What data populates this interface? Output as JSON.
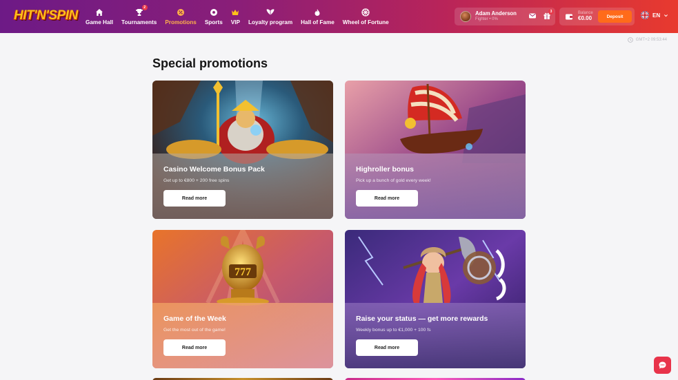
{
  "brand": {
    "logo_text": "HIT'N'SPIN"
  },
  "nav": {
    "items": [
      {
        "label": "Game Hall",
        "icon": "home-icon",
        "active": false
      },
      {
        "label": "Tournaments",
        "icon": "trophy-icon",
        "badge": "2",
        "active": false
      },
      {
        "label": "Promotions",
        "icon": "promo-icon",
        "active": true
      },
      {
        "label": "Sports",
        "icon": "ball-icon",
        "active": false
      },
      {
        "label": "VIP",
        "icon": "crown-icon",
        "active": false
      },
      {
        "label": "Loyalty program",
        "icon": "wings-icon",
        "active": false
      },
      {
        "label": "Hall of Fame",
        "icon": "flame-icon",
        "active": false
      },
      {
        "label": "Wheel of Fortune",
        "icon": "wheel-icon",
        "active": false
      }
    ]
  },
  "user": {
    "name": "Adam Anderson",
    "rank": "Fighter • 0%",
    "gift_badge": "3"
  },
  "balance": {
    "label": "Balance",
    "value": "€0.00",
    "deposit_label": "Deposit"
  },
  "language": {
    "code": "EN"
  },
  "clock": {
    "text": "GMT+2 09:53:44"
  },
  "page": {
    "title": "Special promotions"
  },
  "promotions": [
    {
      "title": "Casino Welcome Bonus Pack",
      "subtitle": "Get up to €800 + 200 free spins",
      "button": "Read more"
    },
    {
      "title": "Highroller bonus",
      "subtitle": "Pick up a bunch of gold every week!",
      "button": "Read more"
    },
    {
      "title": "Game of the Week",
      "subtitle": "Get the most out of the game!",
      "button": "Read more"
    },
    {
      "title": "Raise your status — get more rewards",
      "subtitle": "Weekly bonus up to €1,000 + 100 fs",
      "button": "Read more"
    }
  ],
  "colors": {
    "header_start": "#6d1a86",
    "header_end": "#e83a2e",
    "accent": "#ff6b1a",
    "active_nav": "#ffb14a",
    "chat": "#e8334a"
  }
}
